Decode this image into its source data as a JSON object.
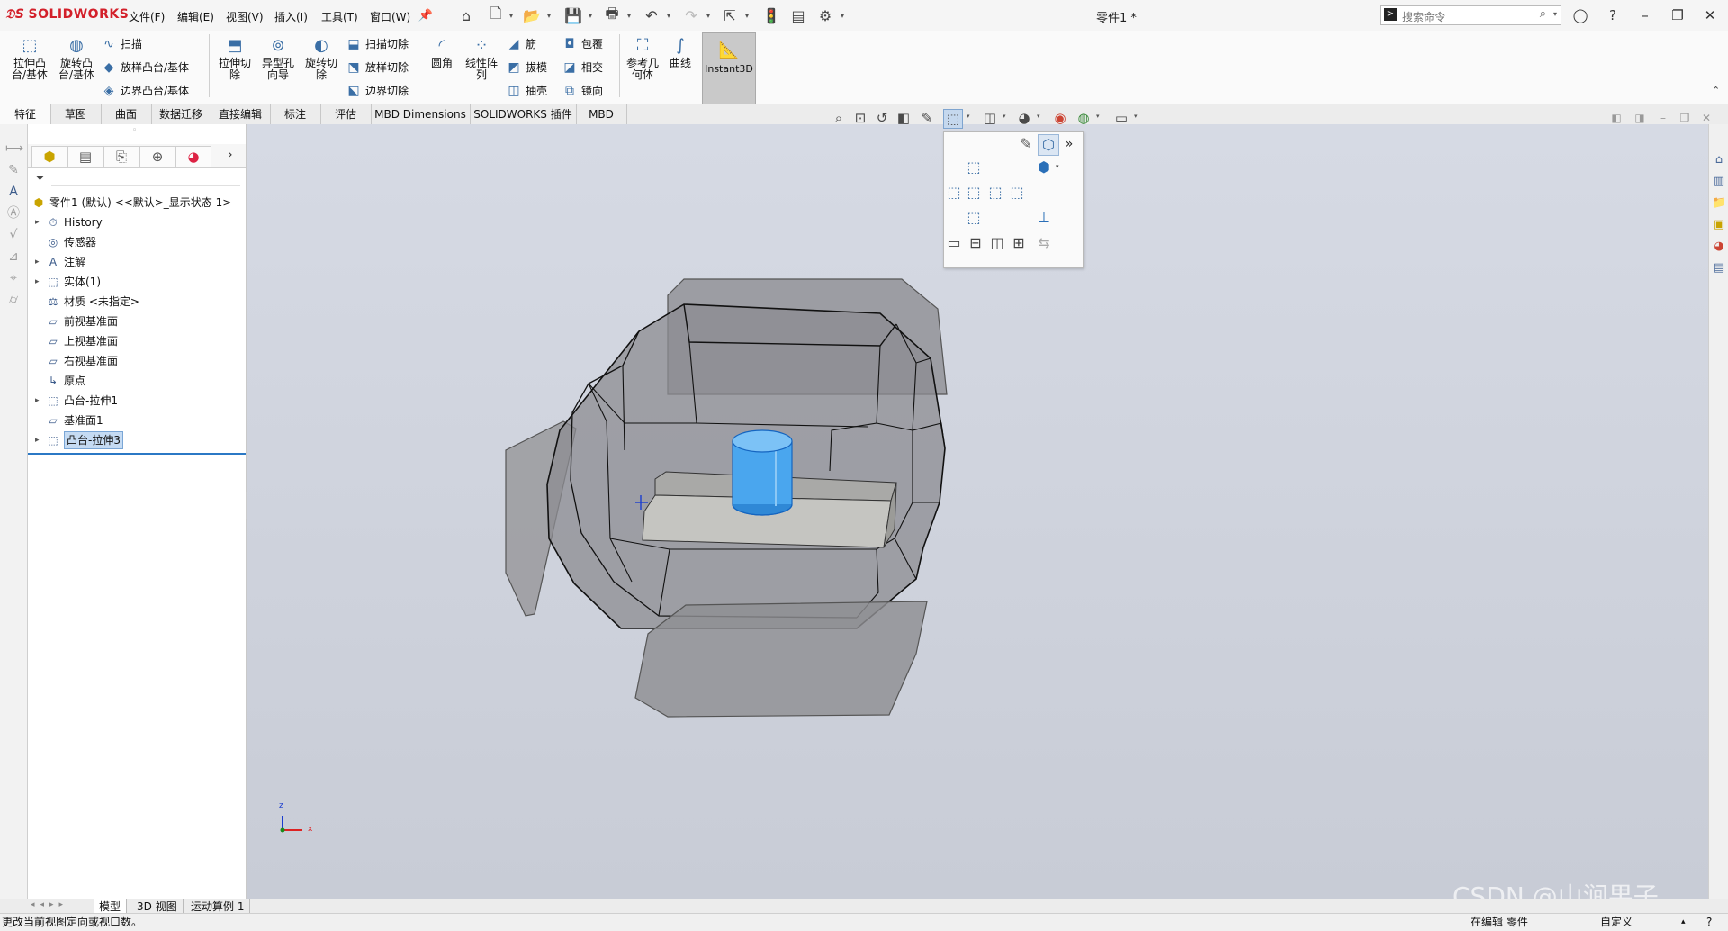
{
  "app": {
    "logo_text": "SOLIDWORKS",
    "document_title": "零件1 *"
  },
  "menus": [
    "文件(F)",
    "编辑(E)",
    "视图(V)",
    "插入(I)",
    "工具(T)",
    "窗口(W)"
  ],
  "search": {
    "placeholder": "搜索命令"
  },
  "ribbon": {
    "extrude_boss": "拉伸凸\n台/基体",
    "revolve_boss": "旋转凸\n台/基体",
    "sweep": "扫描",
    "loft_boss": "放样凸台/基体",
    "boundary_boss": "边界凸台/基体",
    "extrude_cut": "拉伸切\n除",
    "hole_wizard": "异型孔\n向导",
    "revolve_cut": "旋转切\n除",
    "sweep_cut": "扫描切除",
    "loft_cut": "放样切除",
    "boundary_cut": "边界切除",
    "fillet": "圆角",
    "linear_pattern": "线性阵\n列",
    "rib": "筋",
    "draft": "拔模",
    "shell": "抽壳",
    "wrap": "包覆",
    "intersect": "相交",
    "mirror": "镜向",
    "ref_geometry": "参考几\n何体",
    "curves": "曲线",
    "instant3d": "Instant3D"
  },
  "tabs": [
    "特征",
    "草图",
    "曲面",
    "数据迁移",
    "直接编辑",
    "标注",
    "评估",
    "MBD Dimensions",
    "SOLIDWORKS 插件",
    "MBD"
  ],
  "tree": {
    "root": "零件1 (默认) <<默认>_显示状态 1>",
    "items": [
      {
        "label": "History",
        "icon": "history-icon",
        "expandable": true
      },
      {
        "label": "传感器",
        "icon": "sensor-icon",
        "expandable": false
      },
      {
        "label": "注解",
        "icon": "annotation-icon",
        "expandable": true
      },
      {
        "label": "实体(1)",
        "icon": "solid-bodies-icon",
        "expandable": true
      },
      {
        "label": "材质 <未指定>",
        "icon": "material-icon",
        "expandable": false
      },
      {
        "label": "前视基准面",
        "icon": "plane-icon",
        "expandable": false
      },
      {
        "label": "上视基准面",
        "icon": "plane-icon",
        "expandable": false
      },
      {
        "label": "右视基准面",
        "icon": "plane-icon",
        "expandable": false
      },
      {
        "label": "原点",
        "icon": "origin-icon",
        "expandable": false
      },
      {
        "label": "凸台-拉伸1",
        "icon": "extrude-icon",
        "expandable": true
      },
      {
        "label": "基准面1",
        "icon": "plane-icon",
        "expandable": false
      },
      {
        "label": "凸台-拉伸3",
        "icon": "extrude-icon",
        "expandable": true,
        "selected": true
      }
    ]
  },
  "bottom_tabs": [
    "模型",
    "3D 视图",
    "运动算例 1"
  ],
  "status": {
    "left": "更改当前视图定向或视口数。",
    "mode": "在编辑 零件",
    "units": "自定义"
  },
  "watermark": "CSDN @山涧果子",
  "triad": {
    "x": "x",
    "z": "z"
  },
  "colors": {
    "brand": "#d3202a",
    "selection": "#c5dbf3",
    "accent_body": "#3b9be8",
    "viewport": "#d0d4de"
  }
}
